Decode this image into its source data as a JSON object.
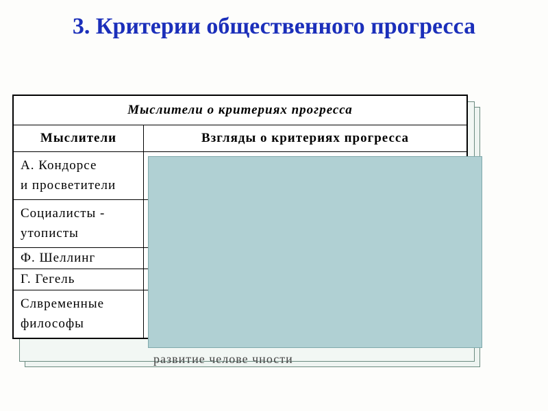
{
  "title": "3. Критерии общественного прогресса",
  "table": {
    "caption": "Мыслители   о  критериях   прогресса",
    "headers": {
      "col1": "Мыслители",
      "col2": "Взгляды о критериях прогресса"
    },
    "rows": [
      {
        "thinker": "А. Кондорсе\nи просветители"
      },
      {
        "thinker": "Социалисты ‑\nутописты"
      },
      {
        "thinker": "Ф. Шеллинг"
      },
      {
        "thinker": "Г. Гегель"
      },
      {
        "thinker": "Слвременные\nфилософы"
      }
    ],
    "partial_bottom_text": "развитие  челове чности"
  }
}
